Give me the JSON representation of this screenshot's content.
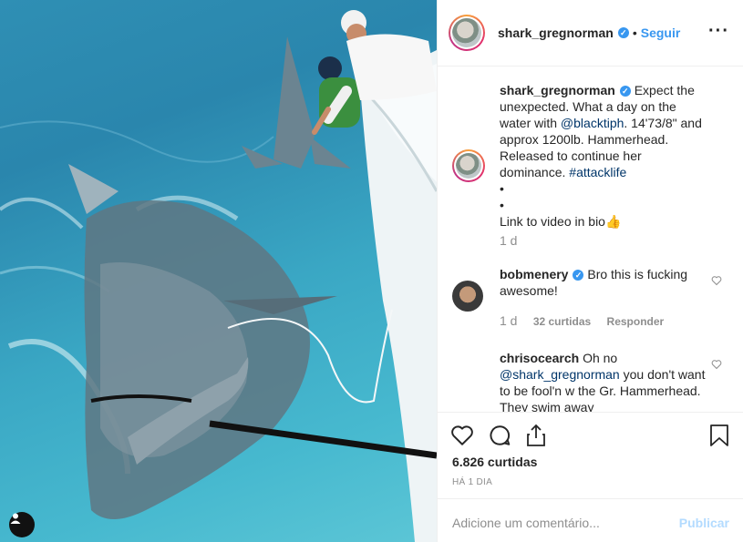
{
  "post": {
    "username": "shark_gregnorman",
    "follow_label": "Seguir",
    "more_icon": "more-options-icon",
    "verified_icon": "verified-badge-icon"
  },
  "caption": {
    "username": "shark_gregnorman",
    "text_before_link": "Expect the unexpected. What a day on the water with ",
    "mention": "@blacktiph",
    "text_after_link": ". 14'73/8\" and approx 1200lb. Hammerhead. Released to continue her dominance. ",
    "hashtag": "#attacklife",
    "bullet1": "•",
    "bullet2": "•",
    "line_final": "Link to video in bio",
    "emoji": "👍",
    "age": "1 d"
  },
  "comments": [
    {
      "username": "bobmenery",
      "text": "Bro this is fucking awesome!",
      "age": "1 d",
      "likes": "32 curtidas",
      "reply": "Responder"
    },
    {
      "username": "chrisocearch",
      "text_before": "Oh no ",
      "mention": "@shark_gregnorman",
      "text_after": " you don't want to be fool'n w the Gr. Hammerhead. They swim away"
    }
  ],
  "actions": {
    "likes_count": "6.826 curtidas",
    "posted_time": "HÁ 1 DIA"
  },
  "add_comment": {
    "placeholder": "Adicione um comentário...",
    "publish_label": "Publicar"
  },
  "colors": {
    "accent": "#3897f0",
    "link": "#003569",
    "muted": "#8e8e8e",
    "water": "#2f8fb4"
  }
}
